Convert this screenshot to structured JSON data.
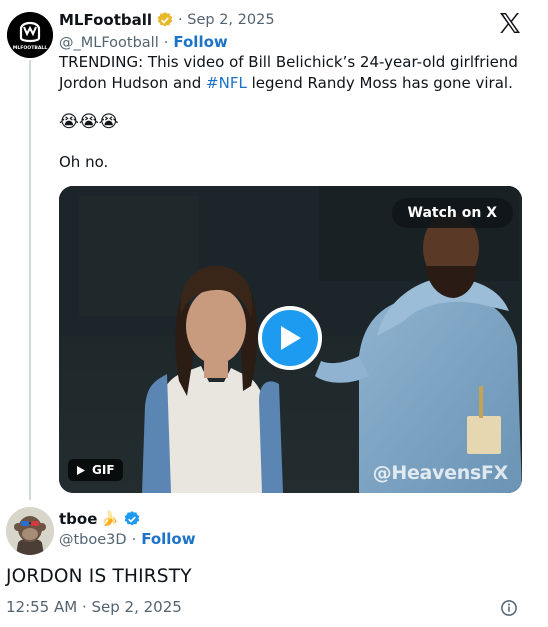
{
  "tweet": {
    "author_name": "MLFootball",
    "date": "· Sep 2, 2025",
    "handle": "@_MLFootball",
    "separator": "·",
    "follow_label": "Follow",
    "avatar_text": "MLFOOTBALL",
    "text_line1": "TRENDING: This video of Bill Belichick’s 24-year-old girlfriend",
    "text_line2_pre": "Jordon Hudson and ",
    "hashtag": "#NFL",
    "text_line2_post": " legend Randy Moss has gone viral.",
    "emojis": "😭😭😭",
    "text_line3": "Oh no."
  },
  "media": {
    "watch_label": "Watch on X",
    "gif_label": "GIF",
    "watermark": "@HeavensFX"
  },
  "reply": {
    "author_name": "tboe",
    "name_emoji": "🍌",
    "handle": "@tboe3D",
    "separator": "·",
    "follow_label": "Follow",
    "text": "JORDON IS THIRSTY",
    "timestamp": "12:55 AM · Sep 2, 2025"
  },
  "colors": {
    "link": "#1d73c8",
    "verified_gold": "#e8b829",
    "verified_blue": "#1d9bf0"
  },
  "icons": [
    "x-logo-icon",
    "verified-gold-icon",
    "verified-blue-icon",
    "play-icon",
    "gif-play-icon",
    "info-icon"
  ]
}
